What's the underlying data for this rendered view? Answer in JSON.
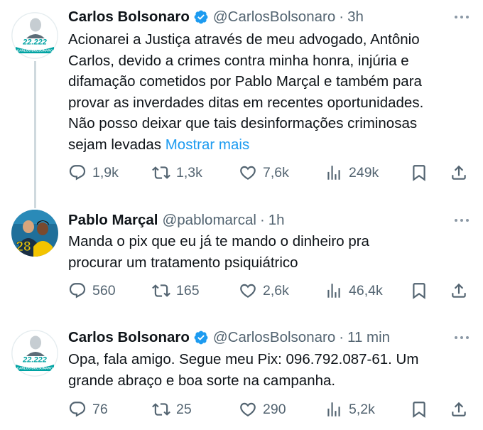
{
  "tweets": [
    {
      "name": "Carlos Bolsonaro",
      "handle": "@CarlosBolsonaro",
      "sep": "·",
      "time": "3h",
      "verified": true,
      "avatar_label": "22.222",
      "avatar_sublabel": "CARLOS BOLSONARO",
      "text_lines": [
        "Acionarei a Justiça através de meu advogado, Antônio",
        "Carlos, devido a crimes contra minha honra, injúria e",
        "difamação cometidos por Pablo Marçal e também para",
        "provar as inverdades ditas em recentes oportunidades.",
        "Não posso deixar que tais desinformações criminosas",
        "sejam levadas "
      ],
      "show_more": "Mostrar mais",
      "replies": "1,9k",
      "retweets": "1,3k",
      "likes": "7,6k",
      "views": "249k"
    },
    {
      "name": "Pablo Marçal",
      "handle": "@pablomarcal",
      "sep": "·",
      "time": "1h",
      "verified": false,
      "avatar_label": "28",
      "text_lines": [
        "Manda o pix que eu já te mando o dinheiro pra",
        "procurar um tratamento psiquiátrico"
      ],
      "replies": "560",
      "retweets": "165",
      "likes": "2,6k",
      "views": "46,4k"
    },
    {
      "name": "Carlos Bolsonaro",
      "handle": "@CarlosBolsonaro",
      "sep": "·",
      "time": "11 min",
      "verified": true,
      "avatar_label": "22.222",
      "avatar_sublabel": "CARLOS BOLSONARO",
      "text_lines": [
        "Opa, fala amigo. Segue meu Pix: 096.792.087-61. Um",
        "grande abraço e boa sorte na campanha."
      ],
      "replies": "76",
      "retweets": "25",
      "likes": "290",
      "views": "5,2k"
    }
  ],
  "colors": {
    "text": "#0f1419",
    "muted": "#536471",
    "link": "#1d9bf0",
    "verified": "#1d9bf0",
    "thread_line": "#cfd9de"
  },
  "icons": [
    "reply-icon",
    "retweet-icon",
    "like-icon",
    "views-icon",
    "bookmark-icon",
    "share-icon",
    "verified-badge-icon",
    "more-icon"
  ]
}
